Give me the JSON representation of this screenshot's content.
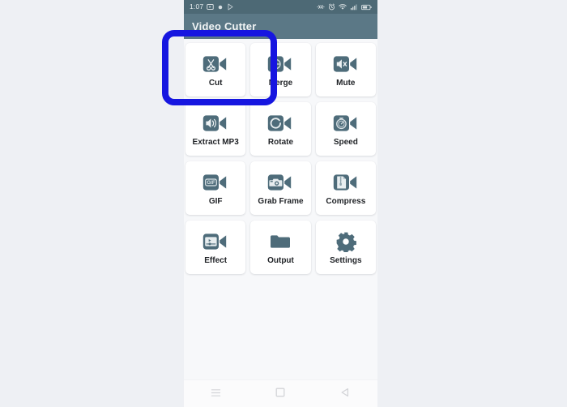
{
  "status_bar": {
    "clock": "1:07",
    "left_icons": [
      "screenshot-icon",
      "record-dot-icon",
      "play-store-icon"
    ],
    "right_icons": [
      "cast-icon",
      "alarm-icon",
      "wifi-icon",
      "signal-icon",
      "battery-icon"
    ]
  },
  "app_bar": {
    "title": "Video Cutter",
    "background": "#5b7886"
  },
  "colors": {
    "accent": "#5b7886",
    "icon_fill": "#4e6c7a",
    "highlight": "#1616e0",
    "page_background": "#eef0f4",
    "screen_background": "#f7f8fa"
  },
  "tools": [
    {
      "label": "Cut",
      "icon": "video-scissors-icon"
    },
    {
      "label": "Merge",
      "icon": "video-merge-icon"
    },
    {
      "label": "Mute",
      "icon": "video-mute-icon"
    },
    {
      "label": "Extract MP3",
      "icon": "video-speaker-icon"
    },
    {
      "label": "Rotate",
      "icon": "video-rotate-icon"
    },
    {
      "label": "Speed",
      "icon": "video-stopwatch-icon"
    },
    {
      "label": "GIF",
      "icon": "video-gif-icon"
    },
    {
      "label": "Grab Frame",
      "icon": "video-camera-icon"
    },
    {
      "label": "Compress",
      "icon": "video-zip-icon"
    },
    {
      "label": "Effect",
      "icon": "video-effect-icon"
    },
    {
      "label": "Output",
      "icon": "folder-icon"
    },
    {
      "label": "Settings",
      "icon": "gear-icon"
    }
  ],
  "nav_bar": {
    "buttons": [
      {
        "name": "recents-button",
        "icon": "menu-icon"
      },
      {
        "name": "home-button",
        "icon": "square-icon"
      },
      {
        "name": "back-button",
        "icon": "triangle-left-icon"
      }
    ]
  },
  "annotation": {
    "target": "Cut",
    "shape": "rounded-rectangle-outline",
    "color": "#1616e0"
  }
}
